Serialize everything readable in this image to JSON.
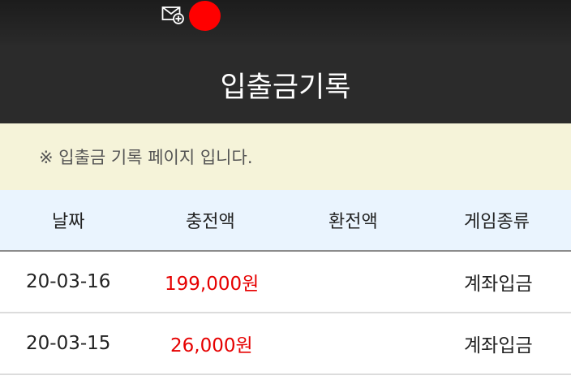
{
  "top_bar": {
    "icons": [
      "mail-add-icon",
      "notification-dot"
    ],
    "accent_color": "#ff0000"
  },
  "header": {
    "title": "입출금기록"
  },
  "notice": {
    "text": "※ 입출금 기록 페이지 입니다."
  },
  "table": {
    "columns": [
      "날짜",
      "충전액",
      "환전액",
      "게임종류"
    ],
    "rows": [
      {
        "date": "20-03-16",
        "deposit": "199,000원",
        "withdraw": "",
        "game": "계좌입금"
      },
      {
        "date": "20-03-15",
        "deposit": "26,000원",
        "withdraw": "",
        "game": "계좌입금"
      }
    ],
    "deposit_color": "#e60000"
  }
}
